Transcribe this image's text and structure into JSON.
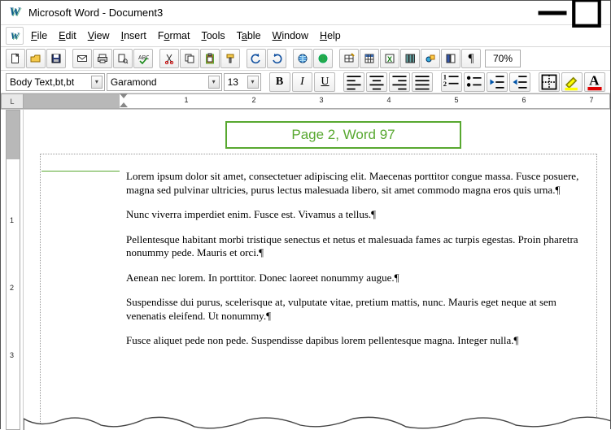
{
  "window": {
    "app": "Microsoft Word",
    "document": "Document3",
    "title": "Microsoft Word - Document3"
  },
  "menu": {
    "file": "File",
    "edit": "Edit",
    "view": "View",
    "insert": "Insert",
    "format": "Format",
    "tools": "Tools",
    "table": "Table",
    "window": "Window",
    "help": "Help"
  },
  "toolbar": {
    "zoom": "70%"
  },
  "format": {
    "style": "Body Text,bt,bt",
    "font": "Garamond",
    "size": "13",
    "bold": "B",
    "italic": "I",
    "underline": "U"
  },
  "ruler": {
    "corner": "L",
    "h_numbers": [
      "1",
      "2",
      "3",
      "4",
      "5",
      "6",
      "7"
    ],
    "v_numbers": [
      "1",
      "2",
      "3"
    ]
  },
  "callout": {
    "text": "Page 2, Word 97"
  },
  "body": {
    "p1": "Lorem ipsum dolor sit amet, consectetuer adipiscing elit. Maecenas porttitor congue massa. Fusce posuere, magna sed pulvinar ultricies, purus lectus malesuada libero, sit amet commodo magna eros quis urna.¶",
    "p2": "Nunc viverra imperdiet enim. Fusce est. Vivamus a tellus.¶",
    "p3": "Pellentesque habitant morbi tristique senectus et netus et malesuada fames ac turpis egestas. Proin pharetra nonummy pede. Mauris et orci.¶",
    "p4": "Aenean nec lorem. In porttitor. Donec laoreet nonummy augue.¶",
    "p5": "Suspendisse dui purus, scelerisque at, vulputate vitae, pretium mattis, nunc. Mauris eget neque at sem venenatis eleifend. Ut nonummy.¶",
    "p6": "Fusce aliquet pede non pede. Suspendisse dapibus lorem pellentesque magna. Integer nulla.¶"
  },
  "icons": {
    "new": "new-icon",
    "open": "open-icon",
    "save": "save-icon",
    "mail": "mail-icon",
    "print": "print-icon",
    "preview": "preview-icon",
    "spell": "spell-icon",
    "cut": "cut-icon",
    "copy": "copy-icon",
    "paste": "paste-icon",
    "fmtpaint": "format-painter-icon",
    "undo": "undo-icon",
    "redo": "redo-icon",
    "link": "hyperlink-icon",
    "web": "web-toolbar-icon",
    "tables": "tables-borders-icon",
    "inserttable": "insert-table-icon",
    "excel": "excel-icon",
    "columns": "columns-icon",
    "drawing": "drawing-icon",
    "docmap": "docmap-icon",
    "pilcrow": "show-hide-icon",
    "alignl": "align-left-icon",
    "alignc": "align-center-icon",
    "alignr": "align-right-icon",
    "alignj": "align-justify-icon",
    "numlist": "numbered-list-icon",
    "bullist": "bullet-list-icon",
    "outdent": "decrease-indent-icon",
    "indent": "increase-indent-icon",
    "borders": "borders-icon",
    "highlight": "highlight-icon",
    "fontcolor": "font-color-icon"
  }
}
